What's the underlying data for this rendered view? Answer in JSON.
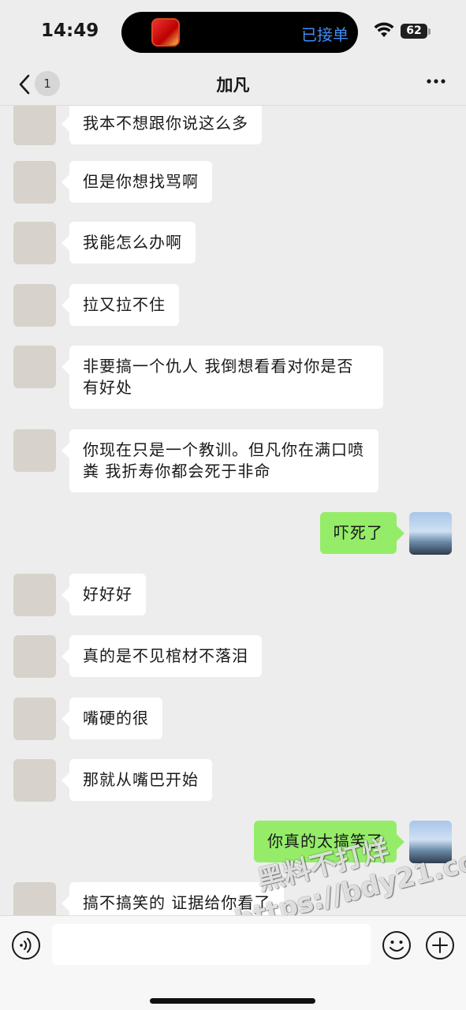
{
  "status_bar": {
    "time": "14:49",
    "island_label": "已接单",
    "battery": "62"
  },
  "nav": {
    "unread_count": "1",
    "title": "加凡"
  },
  "messages": [
    {
      "side": "in",
      "text": "我本不想跟你说这么多"
    },
    {
      "side": "in",
      "text": "但是你想找骂啊"
    },
    {
      "side": "in",
      "text": "我能怎么办啊"
    },
    {
      "side": "in",
      "text": "拉又拉不住"
    },
    {
      "side": "in",
      "text": "非要搞一个仇人 我倒想看看对你是否有好处"
    },
    {
      "side": "in",
      "text": "你现在只是一个教训。但凡你在满口喷粪 我折寿你都会死于非命"
    },
    {
      "side": "out",
      "text": "吓死了"
    },
    {
      "side": "in",
      "text": "好好好"
    },
    {
      "side": "in",
      "text": "真的是不见棺材不落泪"
    },
    {
      "side": "in",
      "text": "嘴硬的很"
    },
    {
      "side": "in",
      "text": "那就从嘴巴开始"
    },
    {
      "side": "out",
      "text": "你真的太搞笑了"
    },
    {
      "side": "in",
      "text": "搞不搞笑的 证据给你看了"
    }
  ],
  "watermark": {
    "line1": "黑料不打烊",
    "line2": "https://bdy21.co"
  },
  "colors": {
    "background": "#ededed",
    "incoming_bubble": "#ffffff",
    "outgoing_bubble": "#95ec69",
    "island_label": "#3e8ef7"
  },
  "icons": [
    "back-icon",
    "more-icon",
    "wifi-icon",
    "voice-icon",
    "emoji-icon",
    "plus-icon"
  ]
}
